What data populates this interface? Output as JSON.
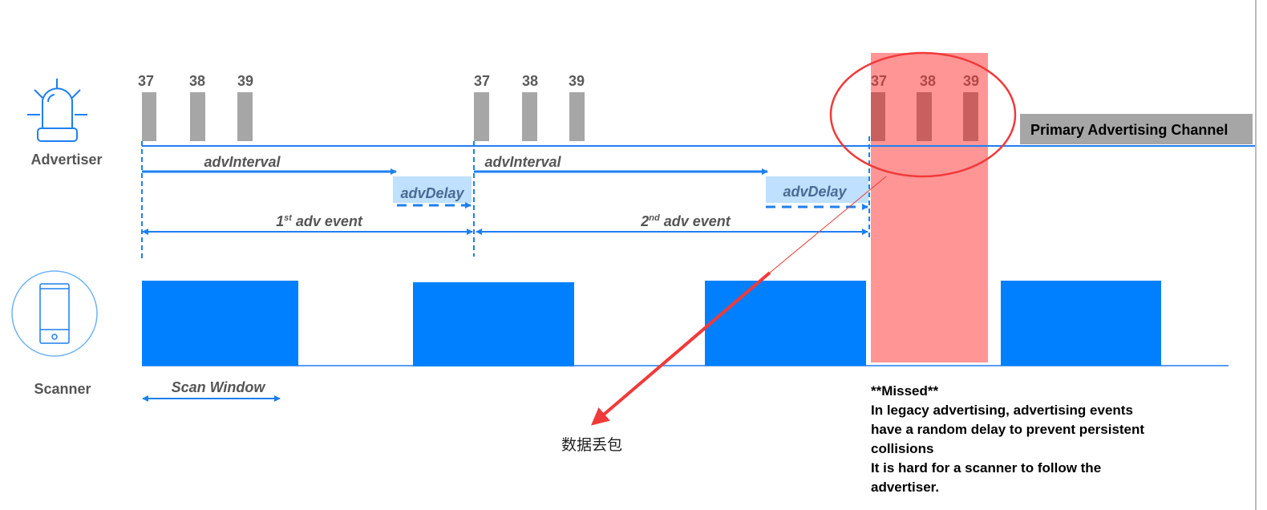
{
  "roles": {
    "advertiser": "Advertiser",
    "scanner": "Scanner"
  },
  "channels": [
    "37",
    "38",
    "39"
  ],
  "primary_channel_label": "Primary Advertising Channel",
  "timing": {
    "adv_interval": "advInterval",
    "adv_delay": "advDelay",
    "event1_ordinal": "1",
    "event1_suffix": "st",
    "event2_ordinal": "2",
    "event2_suffix": "nd",
    "event_label": " adv event",
    "scan_window": "Scan Window"
  },
  "annotation": {
    "title": "**Missed**",
    "lines": [
      "In legacy advertising, advertising events",
      "have a random delay to prevent persistent",
      "collisions",
      "It is hard for a scanner to follow the",
      "advertiser."
    ],
    "callout": "数据丢包"
  },
  "colors": {
    "blue": "#0080ff",
    "gray": "#a6a6a6",
    "missed": "#ff8a8a",
    "red": "#f03a3a",
    "delay_bg": "#bfe0ff"
  }
}
